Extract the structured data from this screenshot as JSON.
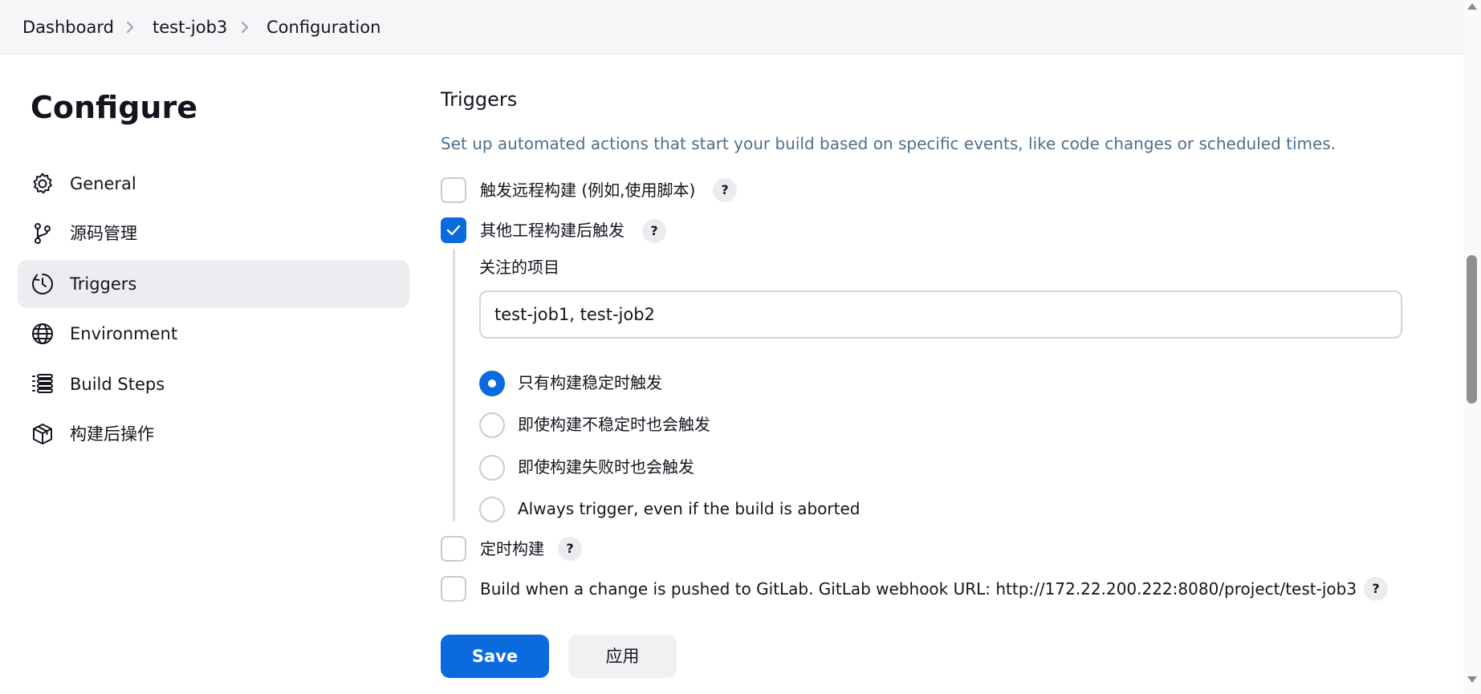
{
  "breadcrumb": {
    "items": [
      "Dashboard",
      "test-job3",
      "Configuration"
    ]
  },
  "sidebar": {
    "title": "Configure",
    "items": [
      {
        "label": "General",
        "icon": "gear-icon"
      },
      {
        "label": "源码管理",
        "icon": "branch-icon"
      },
      {
        "label": "Triggers",
        "icon": "clock-icon",
        "active": true
      },
      {
        "label": "Environment",
        "icon": "globe-icon"
      },
      {
        "label": "Build Steps",
        "icon": "list-icon"
      },
      {
        "label": "构建后操作",
        "icon": "package-icon"
      }
    ]
  },
  "main": {
    "section_title": "Triggers",
    "section_description": "Set up automated actions that start your build based on specific events, like code changes or scheduled times.",
    "triggers": [
      {
        "label": "触发远程构建 (例如,使用脚本)",
        "checked": false,
        "help": "?"
      },
      {
        "label": "其他工程构建后触发",
        "checked": true,
        "help": "?"
      },
      {
        "label": "定时构建",
        "checked": false,
        "help": "?"
      },
      {
        "label": "Build when a change is pushed to GitLab. GitLab webhook URL: http://172.22.200.222:8080/project/test-job3",
        "checked": false,
        "help": "?"
      }
    ],
    "watched_projects": {
      "label": "关注的项目",
      "value": "test-job1, test-job2"
    },
    "trigger_conditions": [
      {
        "label": "只有构建稳定时触发",
        "selected": true
      },
      {
        "label": "即使构建不稳定时也会触发",
        "selected": false
      },
      {
        "label": "即使构建失败时也会触发",
        "selected": false
      },
      {
        "label": "Always trigger, even if the build is aborted",
        "selected": false
      }
    ]
  },
  "actions": {
    "save_label": "Save",
    "apply_label": "应用"
  },
  "colors": {
    "accent": "#0b6bde",
    "description_text": "#4e6e8e",
    "active_nav_bg": "#ececf1"
  }
}
